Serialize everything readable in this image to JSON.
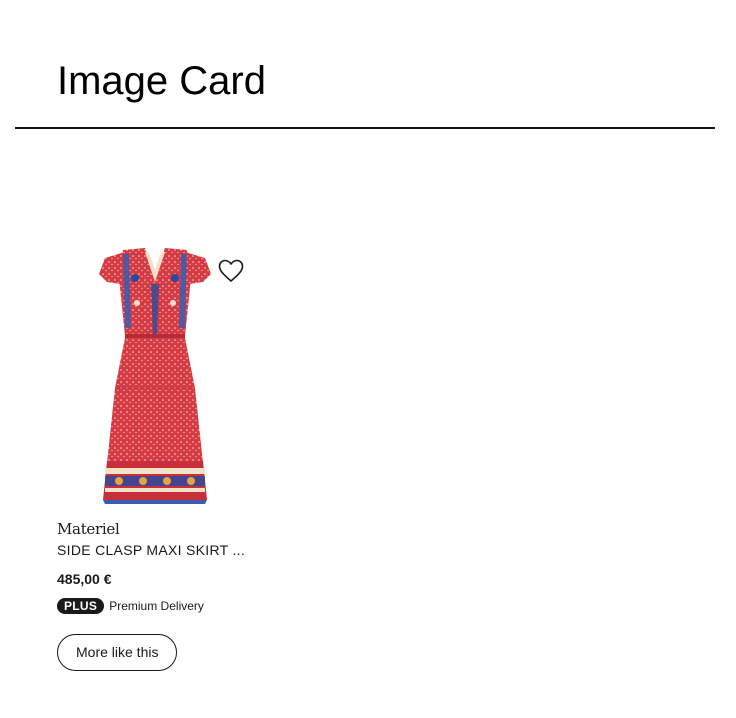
{
  "page": {
    "title": "Image Card"
  },
  "card": {
    "image_alt": "Red floral print maxi dress with flutter sleeves",
    "wishlist_icon": "heart-outline-icon",
    "brand": "Materiel",
    "product_name": "SIDE CLASP MAXI SKIRT ...",
    "price": "485,00 €",
    "badge": "PLUS",
    "delivery": "Premium Delivery",
    "more_button": "More like this"
  },
  "colors": {
    "dress_red": "#d63b44",
    "text": "#1a1a1a",
    "badge_bg": "#1a1a1a"
  }
}
